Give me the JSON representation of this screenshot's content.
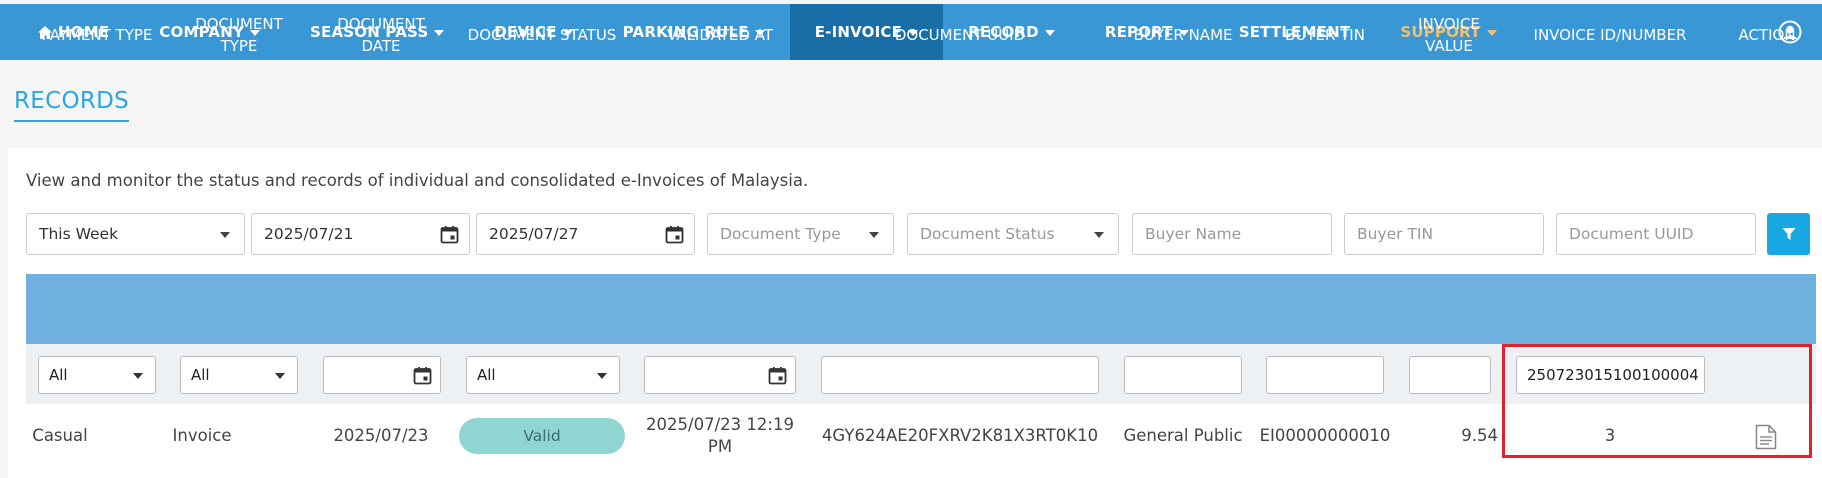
{
  "nav": {
    "home": "HOME",
    "company": "COMPANY",
    "season_pass": "SEASON PASS",
    "device": "DEVICE",
    "parking_rule": "PARKING RULE",
    "e_invoice": "E-INVOICE",
    "record": "RECORD",
    "report": "REPORT",
    "settlement": "SETTLEMENT",
    "support": "SUPPORT"
  },
  "page": {
    "title": "RECORDS",
    "description": "View and monitor the status and records of individual and consolidated e-Invoices of Malaysia."
  },
  "filters": {
    "period": "This Week",
    "date_from": "2025/07/21",
    "date_to": "2025/07/27",
    "document_type_placeholder": "Document Type",
    "document_status_placeholder": "Document Status",
    "buyer_name_placeholder": "Buyer Name",
    "buyer_tin_placeholder": "Buyer TIN",
    "document_uuid_placeholder": "Document UUID"
  },
  "table": {
    "headers": {
      "payment_type": "PAYMENT TYPE",
      "document_type_1": "DOCUMENT",
      "document_type_2": "TYPE",
      "document_date_1": "DOCUMENT",
      "document_date_2": "DATE",
      "document_status": "DOCUMENT STATUS",
      "validated_at": "VALIDATED AT",
      "document_uuid": "DOCUMENT UUID",
      "buyer_name": "BUYER NAME",
      "buyer_tin": "BUYER TIN",
      "invoice_value_1": "INVOICE",
      "invoice_value_2": "VALUE",
      "invoice_id": "INVOICE ID/NUMBER",
      "action": "ACTION"
    },
    "column_filters": {
      "payment_type": "All",
      "document_type": "All",
      "document_status": "All",
      "invoice_id": "250723015100100004"
    },
    "row": {
      "payment_type": "Casual",
      "document_type": "Invoice",
      "document_date": "2025/07/23",
      "document_status": "Valid",
      "validated_at_1": "2025/07/23 12:19",
      "validated_at_2": "PM",
      "document_uuid": "4GY624AE20FXRV2K81X3RT0K10",
      "buyer_name": "General Public",
      "buyer_tin": "EI00000000010",
      "invoice_value": "9.54",
      "invoice_id": "3"
    }
  },
  "colors": {
    "navbar": "#3a97d6",
    "navbar_active": "#1a6ea8",
    "support": "#f3c06a",
    "table_header": "#6fb0de",
    "badge_valid": "#8fd6d3",
    "highlight": "#e0232a"
  }
}
